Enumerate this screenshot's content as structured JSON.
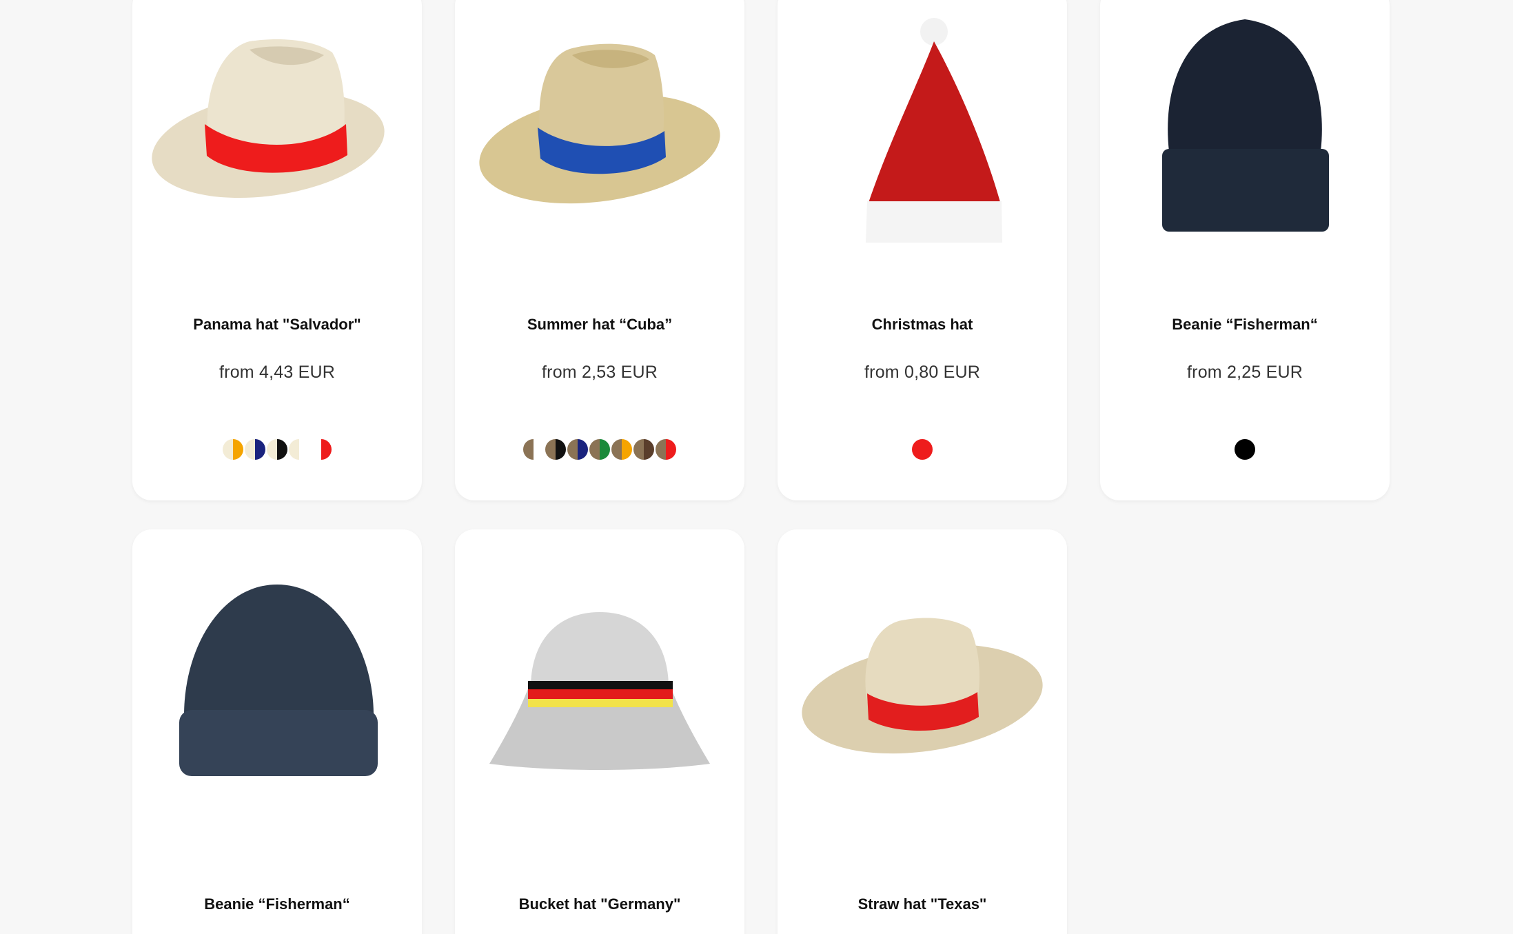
{
  "products": [
    {
      "name": "Panama hat \"Salvador\"",
      "price": "from 4,43 EUR",
      "image": "panama-hat-red-band",
      "colors": [
        [
          "#f3ecd6",
          "#f5a400"
        ],
        [
          "#f3ecd6",
          "#1a237e"
        ],
        [
          "#f3ecd6",
          "#111111"
        ],
        [
          "#f3ecd6",
          "#ffffff"
        ],
        [
          "#ffffff",
          "#ee1c1c"
        ]
      ]
    },
    {
      "name": "Summer hat “Cuba”",
      "price": "from 2,53 EUR",
      "image": "straw-hat-blue-band",
      "colors": [
        [
          "#8b7355",
          "#ffffff"
        ],
        [
          "#8b7355",
          "#111111"
        ],
        [
          "#8b7355",
          "#1a237e"
        ],
        [
          "#8b7355",
          "#1b8a3a"
        ],
        [
          "#8b7355",
          "#f5a400"
        ],
        [
          "#8b7355",
          "#5a3e2b"
        ],
        [
          "#8b7355",
          "#ee1c1c"
        ]
      ]
    },
    {
      "name": "Christmas hat",
      "price": "from 0,80 EUR",
      "image": "santa-hat",
      "colors": [
        [
          "#ee1c1c",
          "#ee1c1c"
        ]
      ]
    },
    {
      "name": "Beanie “Fisherman“",
      "price": "from 2,25 EUR",
      "image": "black-beanie",
      "colors": [
        [
          "#000000",
          "#000000"
        ]
      ]
    },
    {
      "name": "Beanie “Fisherman“",
      "image": "navy-beanie"
    },
    {
      "name": "Bucket hat \"Germany\"",
      "image": "bucket-hat-germany"
    },
    {
      "name": "Straw hat \"Texas\"",
      "image": "straw-hat-texas"
    }
  ]
}
